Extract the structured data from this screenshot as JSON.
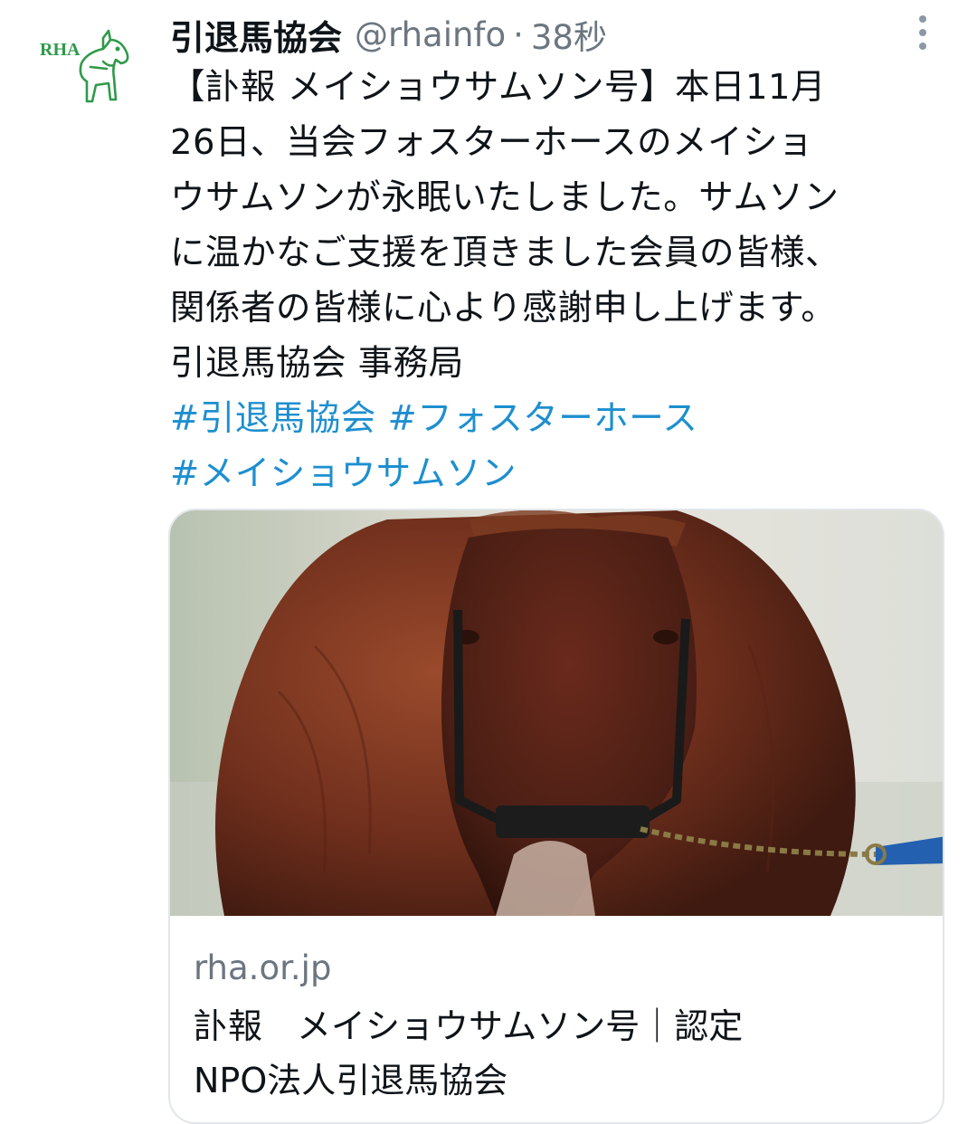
{
  "tweet": {
    "display_name": "引退馬協会",
    "handle": "@rhainfo",
    "separator": "·",
    "time": "38秒",
    "avatar": {
      "logo_text": "RHA",
      "brand_color": "#2e9a4a"
    },
    "body_lines": [
      "【訃報 メイショウサムソン号】本日11月",
      "26日、当会フォスターホースのメイショ",
      "ウサムソンが永眠いたしました。サムソン",
      "に温かなご支援を頂きました会員の皆様、",
      "関係者の皆様に心より感謝申し上げます。",
      "引退馬協会 事務局"
    ],
    "hashtags": [
      "#引退馬協会",
      "#フォスターホース",
      "#メイショウサムソン"
    ],
    "hashtag_color": "#1d8fcf"
  },
  "card": {
    "image": "horse-photo",
    "domain": "rha.or.jp",
    "title_lines": [
      "訃報　メイショウサムソン号｜認定",
      "NPO法人引退馬協会"
    ]
  },
  "icons": {
    "more": "more-vertical-icon"
  }
}
